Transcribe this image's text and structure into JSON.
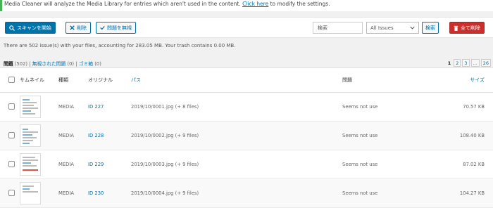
{
  "notice": {
    "text": "Media Cleaner will analyze the Media Library for entries which aren't used in the content.",
    "link_text": "Click here",
    "after_link": "to modify the settings."
  },
  "toolbar": {
    "scan_label": "スキャンを開始",
    "delete_label": "削除",
    "ignore_label": "問題を無視",
    "search_placeholder": "検索",
    "filter_value": "All Issues",
    "search_button": "検索",
    "delete_all_label": "全て削除"
  },
  "summary": "There are 502 issue(s) with your files, accounting for 283.05 MB. Your trash contains 0.00 MB.",
  "filters": {
    "issues_label": "問題",
    "issues_count": "(502)",
    "ignored_label": "無視された問題",
    "ignored_count": "(0)",
    "trash_label": "ゴミ箱",
    "trash_count": "(0)",
    "separator": "|"
  },
  "pager": {
    "current": "1",
    "pages": [
      "2",
      "3",
      "...",
      "26"
    ]
  },
  "table": {
    "headers": {
      "thumbnail": "サムネイル",
      "type": "種類",
      "original": "オリジナル",
      "path": "パス",
      "issue": "問題",
      "size": "サイズ"
    },
    "rows": [
      {
        "type": "MEDIA",
        "id": "ID 227",
        "path": "2019/10/0001.jpg (+ 8 files)",
        "issue": "Seems not use",
        "size": "70.57 KB"
      },
      {
        "type": "MEDIA",
        "id": "ID 228",
        "path": "2019/10/0002.jpg (+ 9 files)",
        "issue": "Seems not use",
        "size": "108.40 KB"
      },
      {
        "type": "MEDIA",
        "id": "ID 229",
        "path": "2019/10/0003.jpg (+ 9 files)",
        "issue": "Seems not use",
        "size": "87.02 KB"
      },
      {
        "type": "MEDIA",
        "id": "ID 230",
        "path": "2019/10/0004.jpg (+ 9 files)",
        "issue": "Seems not use",
        "size": "104.27 KB"
      }
    ]
  },
  "colors": {
    "primary": "#0073aa",
    "danger": "#c9302c",
    "notice_border": "#46b450"
  }
}
